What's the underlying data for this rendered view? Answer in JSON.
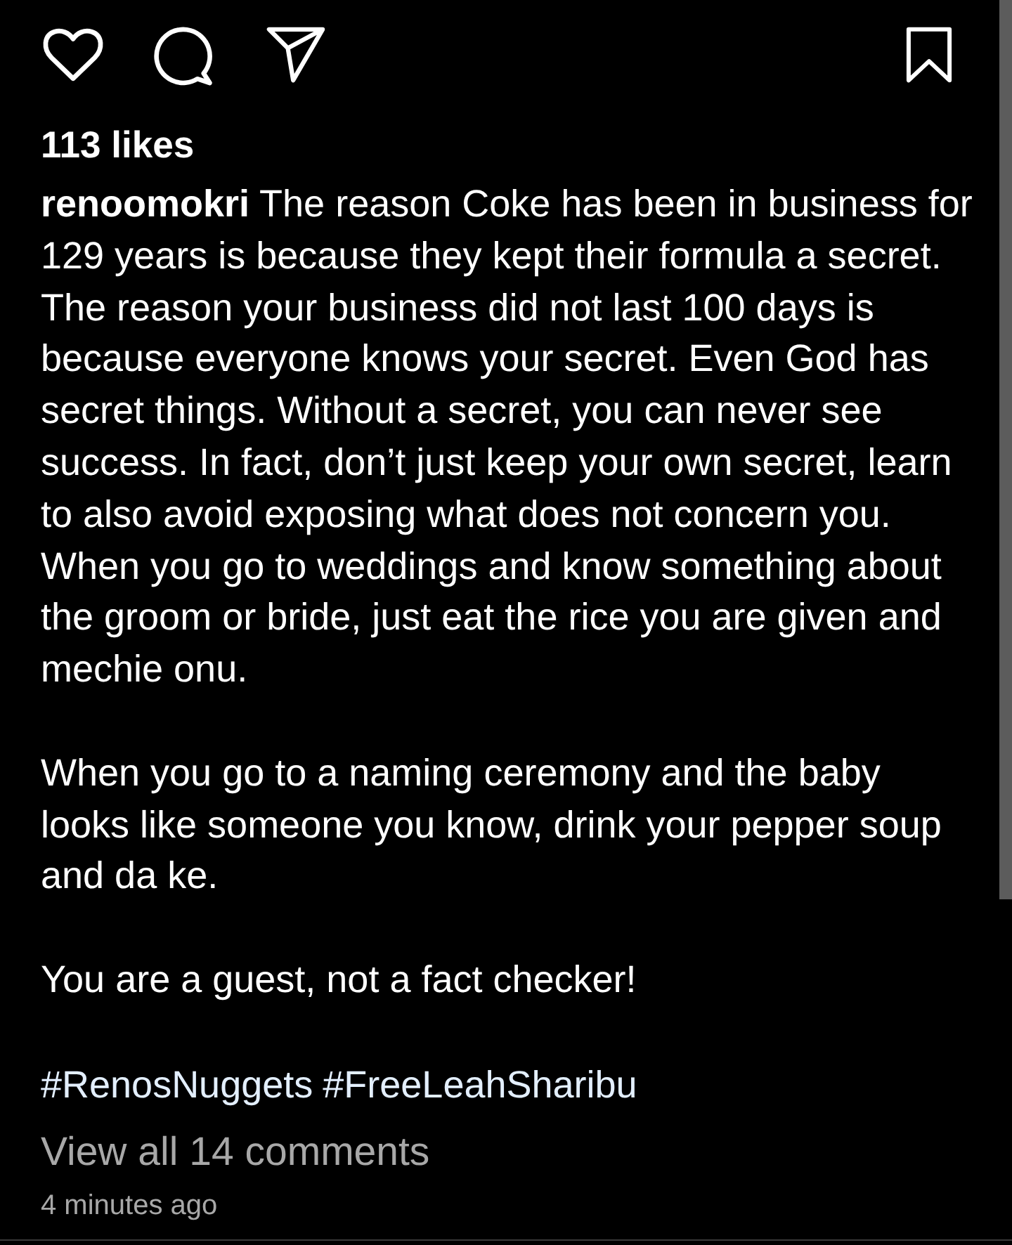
{
  "actions": {
    "liked": false,
    "saved": false
  },
  "likes": "113 likes",
  "caption": {
    "username": "renoomokri",
    "text": "The reason Coke has been in business for 129 years is because they kept their formula a secret. The reason your business did not last 100 days is because everyone knows your secret. Even God has secret things. Without a secret, you can never see success. In fact, don’t just keep your own secret, learn to also avoid exposing what does not concern you. When you go to weddings and know something about the groom or bride, just eat the rice you are given and mechie onu."
  },
  "paragraphs": [
    "When you go to a naming ceremony and the baby looks like someone you know, drink your pepper soup and da ke.",
    "You are a guest, not a fact checker!"
  ],
  "hashtags": [
    "#RenosNuggets",
    "#FreeLeahSharibu"
  ],
  "view_comments": "View all 14 comments",
  "timestamp": "4 minutes ago"
}
